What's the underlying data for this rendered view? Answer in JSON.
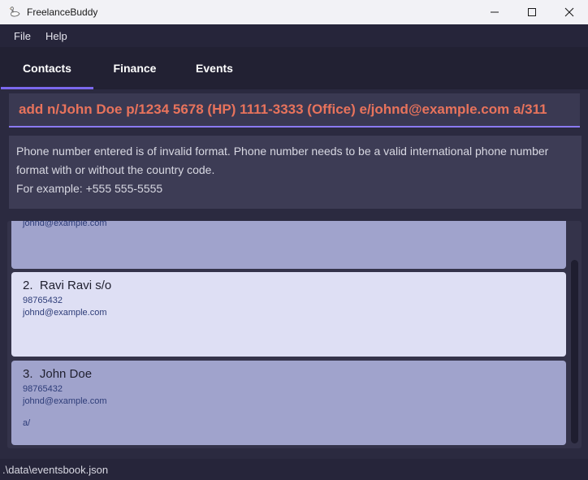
{
  "window": {
    "title": "FreelanceBuddy",
    "app_icon": "goose-icon",
    "minimize_icon": "minimize-icon",
    "maximize_icon": "maximize-icon",
    "close_icon": "close-icon"
  },
  "menu": {
    "items": [
      "File",
      "Help"
    ]
  },
  "tabs": [
    {
      "label": "Contacts",
      "active": true
    },
    {
      "label": "Finance",
      "active": false
    },
    {
      "label": "Events",
      "active": false
    }
  ],
  "command": {
    "value": "add n/John Doe p/1234 5678 (HP) 1111-3333 (Office) e/johnd@example.com a/311"
  },
  "result": {
    "message": "Phone number entered is of invalid format. Phone number needs to be a valid international phone number format with or without the country code.",
    "example": "For example: +555 555-5555"
  },
  "contacts": [
    {
      "email": "johnd@example.com"
    },
    {
      "index": "2.",
      "name": "Ravi Ravi s/o",
      "phone": "98765432",
      "email": "johnd@example.com"
    },
    {
      "index": "3.",
      "name": "John Doe",
      "phone": "98765432",
      "email": "johnd@example.com",
      "address": "a/"
    }
  ],
  "status_bar": {
    "path": ".\\data\\eventsbook.json"
  },
  "colors": {
    "accent": "#7b68ee",
    "command_text": "#e8735c",
    "card_alternate": "#a0a3cc",
    "card_selected": "#dedff4"
  }
}
